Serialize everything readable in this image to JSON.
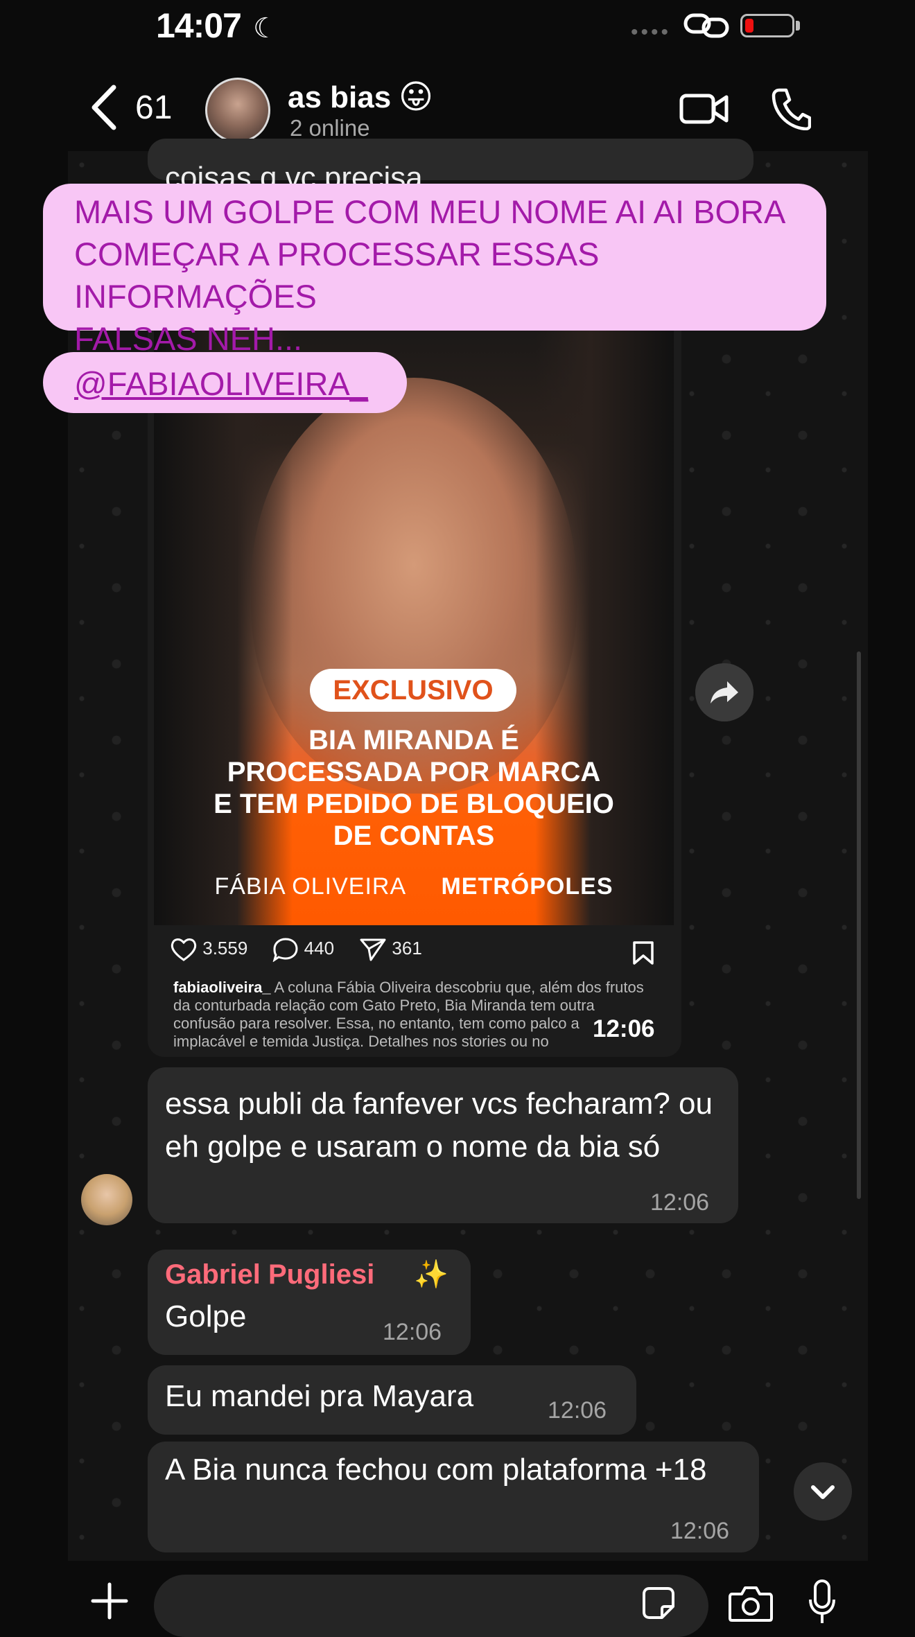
{
  "status_bar": {
    "time": "14:07",
    "moon_icon": "☾",
    "signal_dots": "••••"
  },
  "header": {
    "unread_count": "61",
    "chat_name": "as bias",
    "emoji": "😛",
    "subtitle": "2 online"
  },
  "stories_overlay": {
    "caption_line1": "MAIS UM GOLPE COM MEU NOME AI AI BORA",
    "caption_line2": "COMEÇAR A PROCESSAR ESSAS INFORMAÇÕES",
    "caption_line3": "FALSAS NEH...",
    "mention": "@FABIAOLIVEIRA_"
  },
  "partial_message": {
    "text": "coisas q vc precisa"
  },
  "shared_post": {
    "badge": "EXCLUSIVO",
    "headline_line1": "BIA MIRANDA É",
    "headline_line2": "PROCESSADA POR MARCA",
    "headline_line3": "E TEM PEDIDO DE BLOQUEIO",
    "headline_line4": "DE CONTAS",
    "brand_left": "FÁBIA OLIVEIRA",
    "brand_right": "METRÓPOLES",
    "likes": "3.559",
    "comments": "440",
    "shares": "361",
    "caption_user": "fabiaoliveira_",
    "caption_text": "A coluna Fábia Oliveira descobriu que, além dos frutos da conturbada relação com Gato Preto, Bia Miranda tem outra confusão para resolver. Essa, no entanto, tem como palco a implacável e temida Justiça. Detalhes nos stories ou no",
    "timestamp": "12:06"
  },
  "messages": [
    {
      "text": "essa publi da fanfever vcs fecharam? ou eh golpe e usaram o nome da bia só",
      "time": "12:06"
    },
    {
      "sender": "Gabriel Pugliesi",
      "sender_emoji": "✨",
      "text": "Golpe",
      "time": "12:06"
    },
    {
      "text": "Eu mandei pra Mayara",
      "time": "12:06"
    },
    {
      "text": "A Bia nunca fechou com plataforma +18",
      "time": "12:06"
    }
  ],
  "colors": {
    "sticker_bg": "#f8c6f5",
    "sticker_text": "#a31aa9",
    "sender_name": "#ff6b7a",
    "post_orange": "#ff5a00"
  },
  "icons": {
    "back": "chevron-left-icon",
    "video": "video-call-icon",
    "call": "phone-icon",
    "forward": "forward-icon",
    "scroll_down": "chevron-down-icon",
    "plus": "plus-icon",
    "sticker": "sticker-icon",
    "camera": "camera-icon",
    "mic": "microphone-icon"
  }
}
